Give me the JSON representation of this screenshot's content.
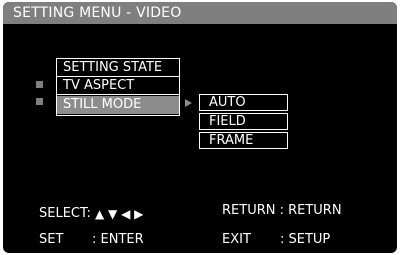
{
  "title": "SETTING MENU - VIDEO",
  "menu": {
    "items": [
      {
        "label": "SETTING STATE"
      },
      {
        "label": "TV ASPECT"
      },
      {
        "label": "STILL MODE"
      }
    ]
  },
  "submenu": {
    "options": [
      {
        "label": "AUTO"
      },
      {
        "label": "FIELD"
      },
      {
        "label": "FRAME"
      }
    ]
  },
  "footer": {
    "select_label": "SELECT:",
    "select_glyphs": "▲ ▼ ◀ ▶",
    "return_text": "RETURN : RETURN",
    "set_label": "SET",
    "set_value": ": ENTER",
    "exit_label": "EXIT",
    "exit_value": ": SETUP"
  },
  "colors": {
    "background": "#000000",
    "title_bar": "#7f7f7f",
    "highlight": "#8c8c8c",
    "text": "#ffffff"
  }
}
